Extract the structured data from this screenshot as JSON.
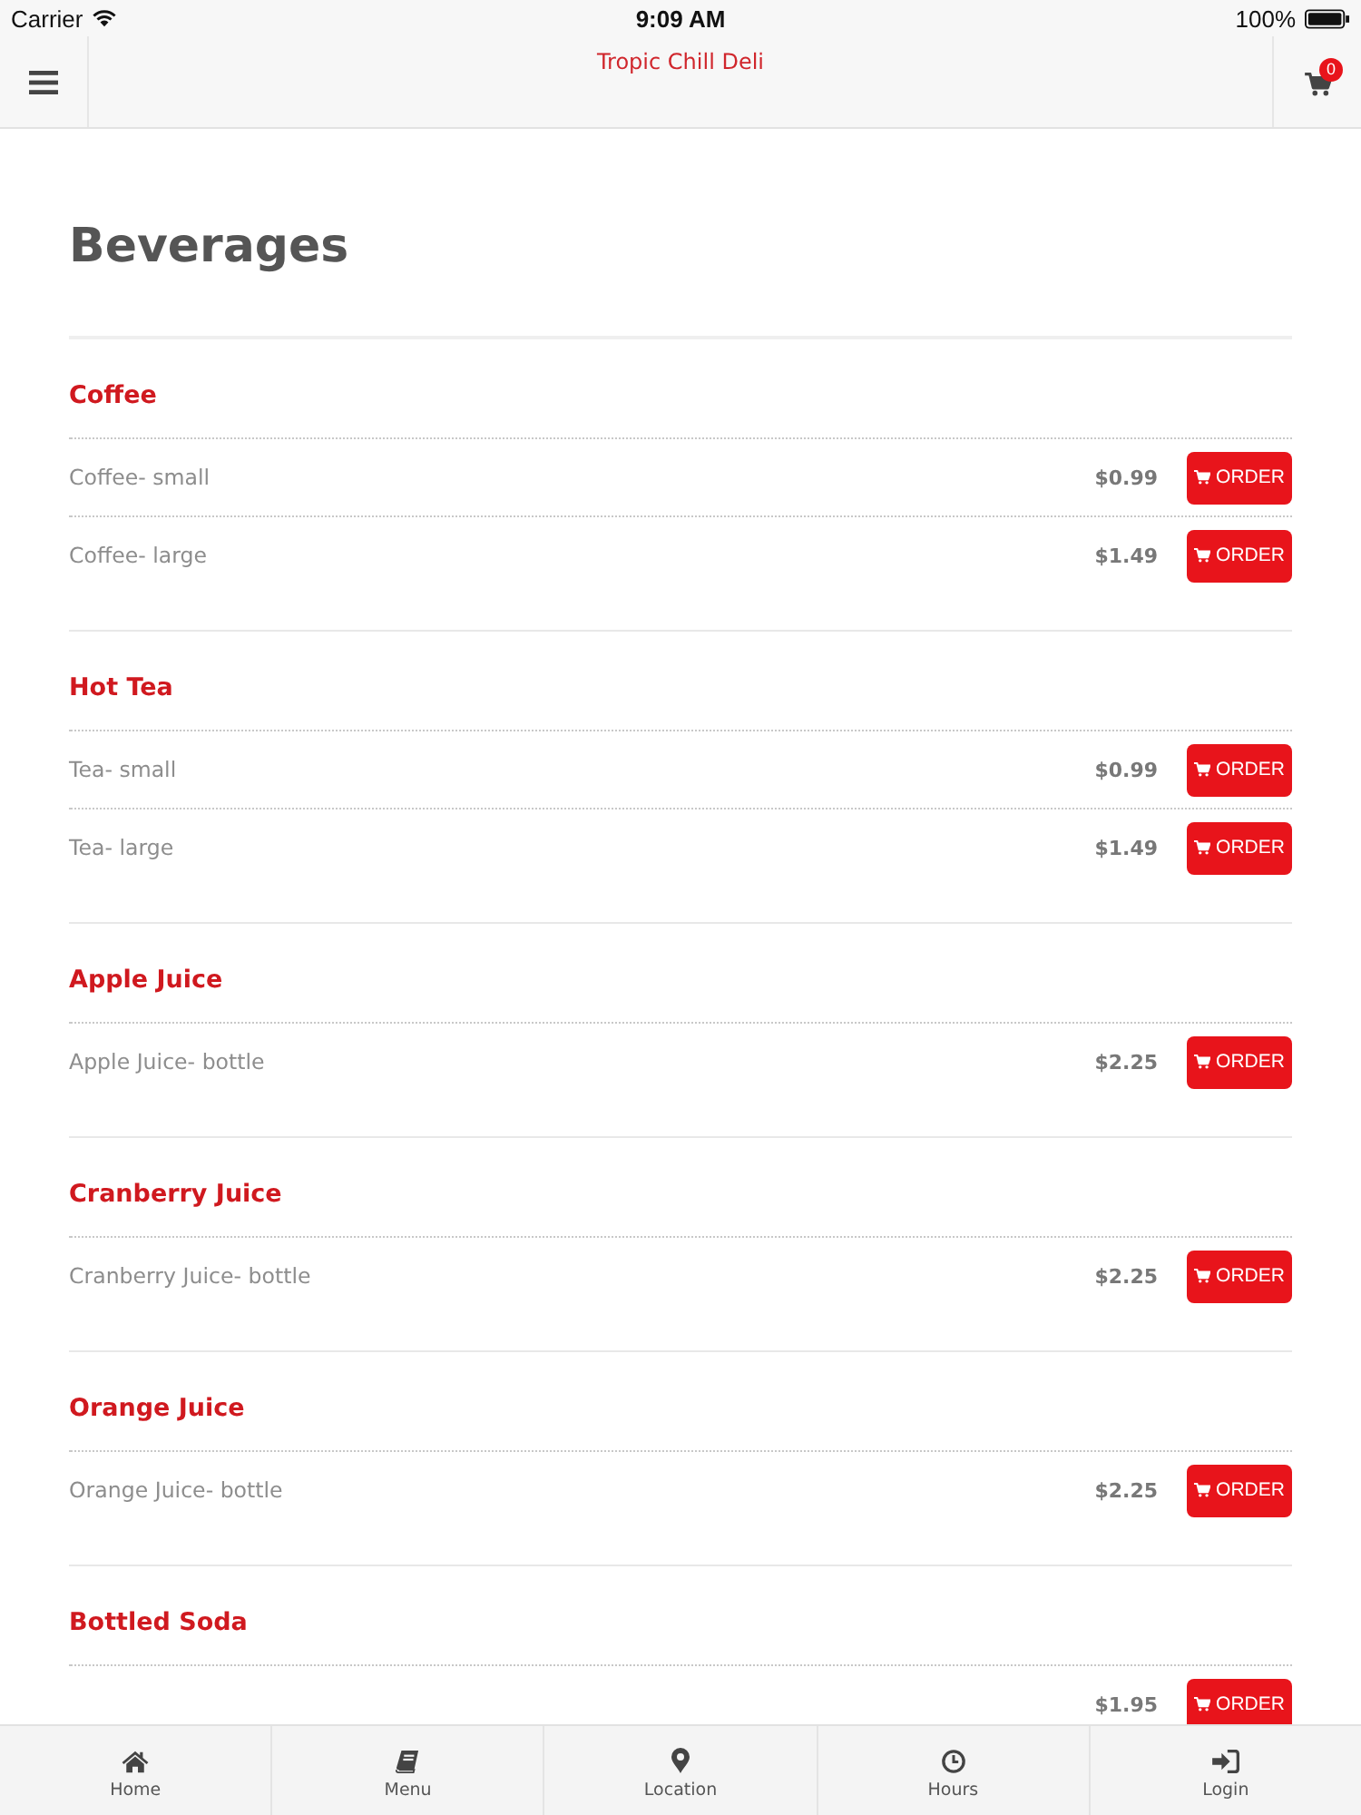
{
  "status_bar": {
    "carrier": "Carrier",
    "time": "9:09 AM",
    "battery": "100%"
  },
  "nav_bar": {
    "title": "Tropic Chill Deli",
    "cart_count": "0"
  },
  "page_title": "Beverages",
  "categories": [
    {
      "title": "Coffee",
      "items": [
        {
          "name": "Coffee- small",
          "price": "$0.99",
          "button": "ORDER"
        },
        {
          "name": "Coffee- large",
          "price": "$1.49",
          "button": "ORDER"
        }
      ]
    },
    {
      "title": "Hot Tea",
      "items": [
        {
          "name": "Tea- small",
          "price": "$0.99",
          "button": "ORDER"
        },
        {
          "name": "Tea- large",
          "price": "$1.49",
          "button": "ORDER"
        }
      ]
    },
    {
      "title": "Apple Juice",
      "items": [
        {
          "name": "Apple Juice- bottle",
          "price": "$2.25",
          "button": "ORDER"
        }
      ]
    },
    {
      "title": "Cranberry Juice",
      "items": [
        {
          "name": "Cranberry Juice- bottle",
          "price": "$2.25",
          "button": "ORDER"
        }
      ]
    },
    {
      "title": "Orange Juice",
      "items": [
        {
          "name": "Orange Juice- bottle",
          "price": "$2.25",
          "button": "ORDER"
        }
      ]
    },
    {
      "title": "Bottled Soda",
      "items": [
        {
          "price": "$1.95",
          "button": "ORDER"
        }
      ]
    }
  ],
  "tab_bar": [
    {
      "label": "Home"
    },
    {
      "label": "Menu"
    },
    {
      "label": "Location"
    },
    {
      "label": "Hours"
    },
    {
      "label": "Login"
    }
  ]
}
